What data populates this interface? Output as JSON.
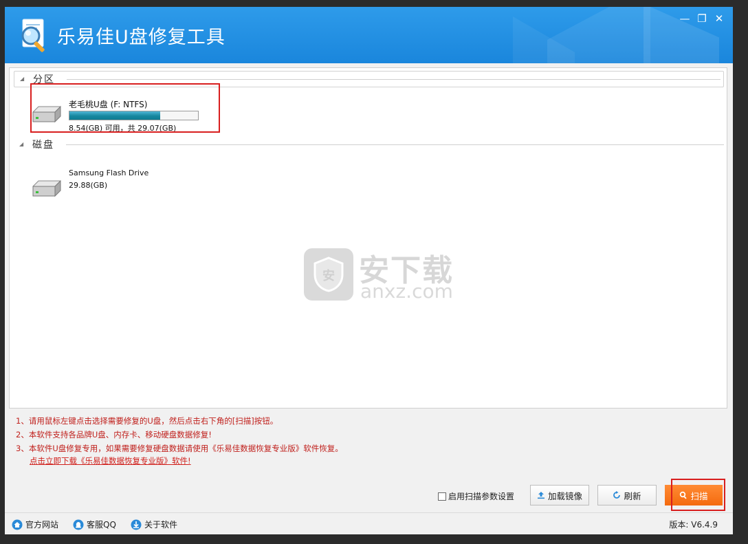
{
  "window": {
    "title": "乐易佳U盘修复工具",
    "controls": {
      "minimize": "—",
      "maximize": "❐",
      "close": "✕"
    }
  },
  "groups": {
    "partition_label": "分区",
    "disk_label": "磁盘"
  },
  "partitions": [
    {
      "name": "老毛桃U盘 (F: NTFS)",
      "usage_fraction": 0.705,
      "info": "8.54(GB) 可用，共 29.07(GB)"
    }
  ],
  "disks": [
    {
      "name": "Samsung Flash Drive",
      "info": "29.88(GB)"
    }
  ],
  "watermark": {
    "cn": "安下载",
    "en": "anxz.com",
    "badge": "安"
  },
  "instructions": [
    "1、请用鼠标左键点击选择需要修复的U盘，然后点击右下角的[扫描]按钮。",
    "2、本软件支持各品牌U盘、内存卡、移动硬盘数据修复!",
    "3、本软件U盘修复专用，如果需要修复硬盘数据请使用《乐易佳数据恢复专业版》软件恢复。"
  ],
  "download_link": "点击立即下载《乐易佳数据恢复专业版》软件!",
  "actions": {
    "scan_params_label": "启用扫描参数设置",
    "scan_params_checked": false,
    "load_image": "加载镜像",
    "refresh": "刷新",
    "scan": "扫描"
  },
  "statusbar": {
    "site": "官方网站",
    "qq": "客服QQ",
    "about": "关于软件",
    "version": "版本: V6.4.9"
  },
  "colors": {
    "title_bar": "#1a86dc",
    "progress_fill": "#16879f",
    "scan_button": "#f46a0e",
    "instruction_text": "#c0201c",
    "highlight": "#d81e1e"
  }
}
